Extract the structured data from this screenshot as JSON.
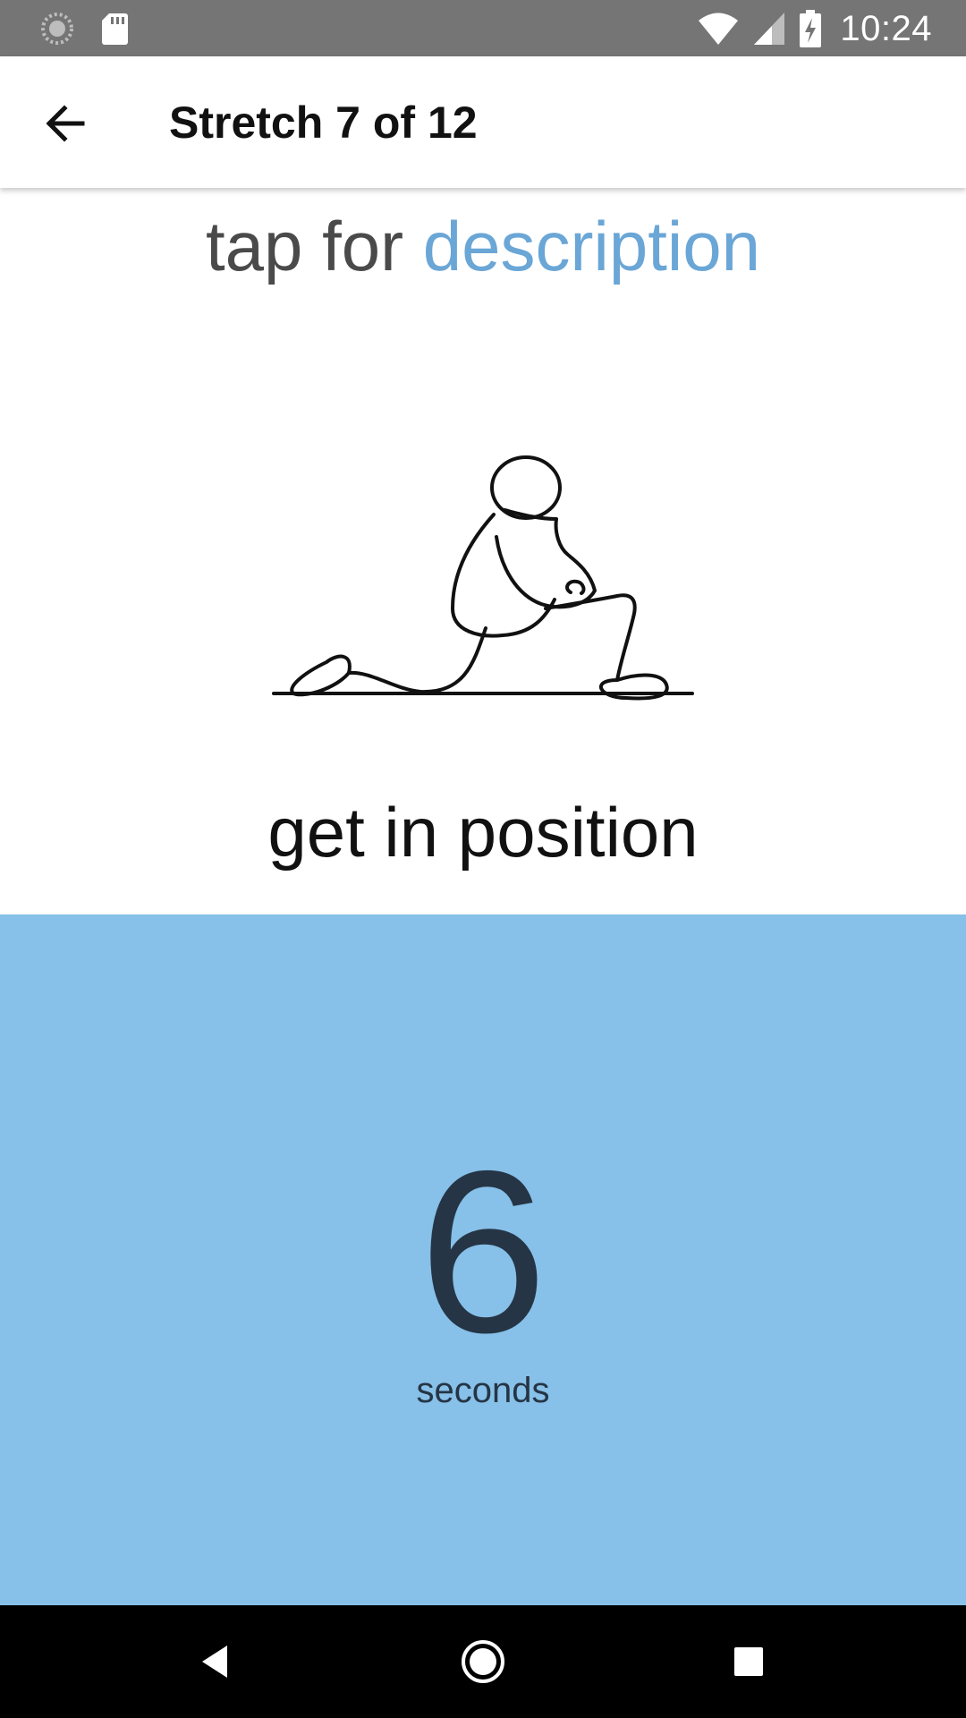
{
  "status_bar": {
    "time": "10:24",
    "icons": [
      "sync-icon",
      "sd-card-icon",
      "wifi-icon",
      "cell-signal-icon",
      "battery-charging-icon"
    ]
  },
  "app_bar": {
    "title": "Stretch 7 of 12",
    "back_icon": "arrow-left-icon"
  },
  "content": {
    "description_prefix": "tap for ",
    "description_link": "description",
    "illustration": "kneeling-lunge-stretch-figure",
    "position_label": "get in position"
  },
  "timer": {
    "value": "6",
    "unit": "seconds"
  },
  "navigation": {
    "icons": [
      "back-triangle-icon",
      "home-circle-icon",
      "recents-square-icon"
    ]
  },
  "colors": {
    "status_bar": "#757575",
    "accent": "#6aa6d6",
    "timer_panel": "#87c0e8",
    "timer_text": "#253545",
    "nav_bar": "#000000"
  }
}
